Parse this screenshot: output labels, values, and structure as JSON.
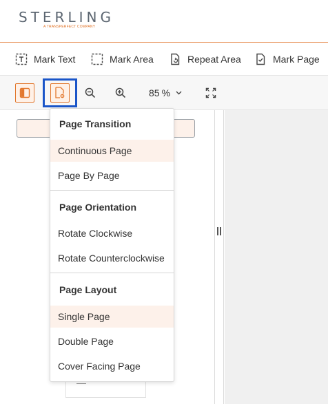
{
  "brand": {
    "name": "STERLING",
    "tagline": "A TRANSPERFECT COMPANY",
    "accent_color": "#e2772d",
    "focus_color": "#1a55c8"
  },
  "toolbar": {
    "mark_text": "Mark Text",
    "mark_area": "Mark Area",
    "repeat_area": "Repeat Area",
    "mark_page": "Mark Page"
  },
  "viewer_toolbar": {
    "zoom_value": "85",
    "zoom_unit": "%"
  },
  "menu": {
    "page_transition": {
      "heading": "Page Transition",
      "items": [
        "Continuous Page",
        "Page By Page"
      ],
      "selected": "Continuous Page"
    },
    "page_orientation": {
      "heading": "Page Orientation",
      "items": [
        "Rotate Clockwise",
        "Rotate Counterclockwise"
      ]
    },
    "page_layout": {
      "heading": "Page Layout",
      "items": [
        "Single Page",
        "Double Page",
        "Cover Facing Page"
      ],
      "selected": "Single Page"
    }
  }
}
